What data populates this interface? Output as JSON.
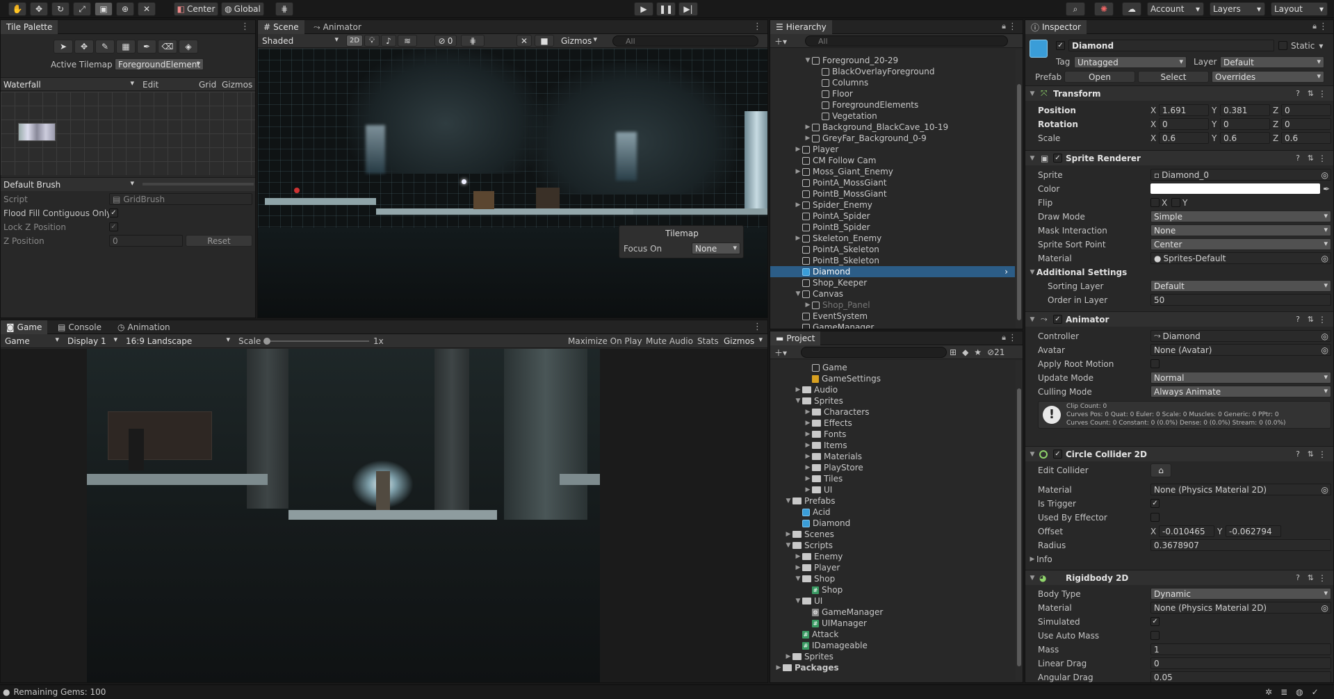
{
  "toolbar": {
    "center_label": "Center",
    "global_label": "Global",
    "account_label": "Account",
    "layers_label": "Layers",
    "layout_label": "Layout"
  },
  "tile_palette": {
    "tab_label": "Tile Palette",
    "active_tilemap_label": "Active Tilemap",
    "active_tilemap_value": "ForegroundElement",
    "palette_value": "Waterfall",
    "edit_label": "Edit",
    "grid_label": "Grid",
    "gizmos_label": "Gizmos",
    "brush_value": "Default Brush",
    "script_label": "Script",
    "script_value": "GridBrush",
    "flood_fill_label": "Flood Fill Contiguous Only",
    "lock_z_label": "Lock Z Position",
    "z_position_label": "Z Position",
    "z_position_value": "0",
    "reset_label": "Reset"
  },
  "scene": {
    "tab_scene": "Scene",
    "tab_animator": "Animator",
    "shading_value": "Shaded",
    "mode_2d": "2D",
    "hidden_count": "0",
    "gizmos_label": "Gizmos",
    "search_placeholder": "All",
    "overlay_title": "Tilemap",
    "focus_on_label": "Focus On",
    "focus_on_value": "None"
  },
  "game": {
    "tab_game": "Game",
    "tab_console": "Console",
    "tab_animation": "Animation",
    "game_dropdown": "Game",
    "display_value": "Display 1",
    "aspect_value": "16:9 Landscape",
    "scale_label": "Scale",
    "scale_value": "1x",
    "maximize_label": "Maximize On Play",
    "mute_label": "Mute Audio",
    "stats_label": "Stats",
    "gizmos_label": "Gizmos"
  },
  "hierarchy": {
    "tab_label": "Hierarchy",
    "search_placeholder": "All",
    "items": [
      {
        "label": "Foreground_20-29",
        "indent": 3,
        "arrow": "down",
        "icon": "cube"
      },
      {
        "label": "BlackOverlayForeground",
        "indent": 4,
        "arrow": "",
        "icon": "cube"
      },
      {
        "label": "Columns",
        "indent": 4,
        "arrow": "",
        "icon": "cube"
      },
      {
        "label": "Floor",
        "indent": 4,
        "arrow": "",
        "icon": "cube"
      },
      {
        "label": "ForegroundElements",
        "indent": 4,
        "arrow": "",
        "icon": "cube"
      },
      {
        "label": "Vegetation",
        "indent": 4,
        "arrow": "",
        "icon": "cube"
      },
      {
        "label": "Background_BlackCave_10-19",
        "indent": 3,
        "arrow": "right",
        "icon": "cube"
      },
      {
        "label": "GreyFar_Background_0-9",
        "indent": 3,
        "arrow": "right",
        "icon": "cube"
      },
      {
        "label": "Player",
        "indent": 2,
        "arrow": "right",
        "icon": "cube"
      },
      {
        "label": "CM Follow Cam",
        "indent": 2,
        "arrow": "",
        "icon": "cube"
      },
      {
        "label": "Moss_Giant_Enemy",
        "indent": 2,
        "arrow": "right",
        "icon": "cube"
      },
      {
        "label": "PointA_MossGiant",
        "indent": 2,
        "arrow": "",
        "icon": "cube"
      },
      {
        "label": "PointB_MossGiant",
        "indent": 2,
        "arrow": "",
        "icon": "cube"
      },
      {
        "label": "Spider_Enemy",
        "indent": 2,
        "arrow": "right",
        "icon": "cube"
      },
      {
        "label": "PointA_Spider",
        "indent": 2,
        "arrow": "",
        "icon": "cube"
      },
      {
        "label": "PointB_Spider",
        "indent": 2,
        "arrow": "",
        "icon": "cube"
      },
      {
        "label": "Skeleton_Enemy",
        "indent": 2,
        "arrow": "right",
        "icon": "cube"
      },
      {
        "label": "PointA_Skeleton",
        "indent": 2,
        "arrow": "",
        "icon": "cube"
      },
      {
        "label": "PointB_Skeleton",
        "indent": 2,
        "arrow": "",
        "icon": "cube"
      },
      {
        "label": "Diamond",
        "indent": 2,
        "arrow": "",
        "icon": "cube-blue",
        "selected": true
      },
      {
        "label": "Shop_Keeper",
        "indent": 2,
        "arrow": "",
        "icon": "cube"
      },
      {
        "label": "Canvas",
        "indent": 2,
        "arrow": "down",
        "icon": "cube"
      },
      {
        "label": "Shop_Panel",
        "indent": 3,
        "arrow": "right",
        "icon": "cube",
        "dim": true
      },
      {
        "label": "EventSystem",
        "indent": 2,
        "arrow": "",
        "icon": "cube"
      },
      {
        "label": "GameManager",
        "indent": 2,
        "arrow": "",
        "icon": "cube"
      }
    ]
  },
  "project": {
    "tab_label": "Project",
    "hidden_count": "21",
    "items": [
      {
        "label": "Game",
        "indent": 3,
        "arrow": "",
        "icon": "unity"
      },
      {
        "label": "GameSettings",
        "indent": 3,
        "arrow": "",
        "icon": "settings"
      },
      {
        "label": "Audio",
        "indent": 2,
        "arrow": "right",
        "icon": "folder"
      },
      {
        "label": "Sprites",
        "indent": 2,
        "arrow": "down",
        "icon": "folder"
      },
      {
        "label": "Characters",
        "indent": 3,
        "arrow": "right",
        "icon": "folder"
      },
      {
        "label": "Effects",
        "indent": 3,
        "arrow": "right",
        "icon": "folder"
      },
      {
        "label": "Fonts",
        "indent": 3,
        "arrow": "right",
        "icon": "folder"
      },
      {
        "label": "Items",
        "indent": 3,
        "arrow": "right",
        "icon": "folder"
      },
      {
        "label": "Materials",
        "indent": 3,
        "arrow": "right",
        "icon": "folder"
      },
      {
        "label": "PlayStore",
        "indent": 3,
        "arrow": "right",
        "icon": "folder"
      },
      {
        "label": "Tiles",
        "indent": 3,
        "arrow": "right",
        "icon": "folder"
      },
      {
        "label": "UI",
        "indent": 3,
        "arrow": "right",
        "icon": "folder"
      },
      {
        "label": "Prefabs",
        "indent": 1,
        "arrow": "down",
        "icon": "folder"
      },
      {
        "label": "Acid",
        "indent": 2,
        "arrow": "",
        "icon": "cube-blue"
      },
      {
        "label": "Diamond",
        "indent": 2,
        "arrow": "",
        "icon": "cube-blue"
      },
      {
        "label": "Scenes",
        "indent": 1,
        "arrow": "right",
        "icon": "folder"
      },
      {
        "label": "Scripts",
        "indent": 1,
        "arrow": "down",
        "icon": "folder"
      },
      {
        "label": "Enemy",
        "indent": 2,
        "arrow": "right",
        "icon": "folder"
      },
      {
        "label": "Player",
        "indent": 2,
        "arrow": "right",
        "icon": "folder"
      },
      {
        "label": "Shop",
        "indent": 2,
        "arrow": "down",
        "icon": "folder"
      },
      {
        "label": "Shop",
        "indent": 3,
        "arrow": "",
        "icon": "script"
      },
      {
        "label": "UI",
        "indent": 2,
        "arrow": "down",
        "icon": "folder"
      },
      {
        "label": "GameManager",
        "indent": 3,
        "arrow": "",
        "icon": "gear"
      },
      {
        "label": "UIManager",
        "indent": 3,
        "arrow": "",
        "icon": "script"
      },
      {
        "label": "Attack",
        "indent": 2,
        "arrow": "",
        "icon": "script"
      },
      {
        "label": "IDamageable",
        "indent": 2,
        "arrow": "",
        "icon": "script"
      },
      {
        "label": "Sprites",
        "indent": 1,
        "arrow": "right",
        "icon": "folder"
      },
      {
        "label": "Packages",
        "indent": 0,
        "arrow": "right",
        "icon": "folder",
        "bold": true
      }
    ]
  },
  "inspector": {
    "tab_label": "Inspector",
    "object_name": "Diamond",
    "static_label": "Static",
    "tag_label": "Tag",
    "tag_value": "Untagged",
    "layer_label": "Layer",
    "layer_value": "Default",
    "prefab_label": "Prefab",
    "open_label": "Open",
    "select_label": "Select",
    "overrides_label": "Overrides",
    "transform": {
      "title": "Transform",
      "position_label": "Position",
      "pos_x": "1.691",
      "pos_y": "0.381",
      "pos_z": "0",
      "rotation_label": "Rotation",
      "rot_x": "0",
      "rot_y": "0",
      "rot_z": "0",
      "scale_label": "Scale",
      "scl_x": "0.6",
      "scl_y": "0.6",
      "scl_z": "0.6"
    },
    "sprite_renderer": {
      "title": "Sprite Renderer",
      "sprite_label": "Sprite",
      "sprite_value": "Diamond_0",
      "color_label": "Color",
      "flip_label": "Flip",
      "flip_x": "X",
      "flip_y": "Y",
      "draw_mode_label": "Draw Mode",
      "draw_mode_value": "Simple",
      "mask_label": "Mask Interaction",
      "mask_value": "None",
      "sort_point_label": "Sprite Sort Point",
      "sort_point_value": "Center",
      "material_label": "Material",
      "material_value": "Sprites-Default",
      "additional_label": "Additional Settings",
      "sorting_layer_label": "Sorting Layer",
      "sorting_layer_value": "Default",
      "order_label": "Order in Layer",
      "order_value": "50"
    },
    "animator": {
      "title": "Animator",
      "controller_label": "Controller",
      "controller_value": "Diamond",
      "avatar_label": "Avatar",
      "avatar_value": "None (Avatar)",
      "root_motion_label": "Apply Root Motion",
      "update_label": "Update Mode",
      "update_value": "Normal",
      "culling_label": "Culling Mode",
      "culling_value": "Always Animate",
      "info_line1": "Clip Count: 0",
      "info_line2": "Curves Pos: 0 Quat: 0 Euler: 0 Scale: 0 Muscles: 0 Generic: 0 PPtr: 0",
      "info_line3": "Curves Count: 0 Constant: 0 (0.0%) Dense: 0 (0.0%) Stream: 0 (0.0%)"
    },
    "circle_collider": {
      "title": "Circle Collider 2D",
      "edit_label": "Edit Collider",
      "material_label": "Material",
      "material_value": "None (Physics Material 2D)",
      "trigger_label": "Is Trigger",
      "effector_label": "Used By Effector",
      "offset_label": "Offset",
      "offset_x": "-0.010465",
      "offset_y": "-0.062794",
      "radius_label": "Radius",
      "radius_value": "0.3678907",
      "info_label": "Info"
    },
    "rigidbody": {
      "title": "Rigidbody 2D",
      "body_type_label": "Body Type",
      "body_type_value": "Dynamic",
      "material_label": "Material",
      "material_value": "None (Physics Material 2D)",
      "simulated_label": "Simulated",
      "auto_mass_label": "Use Auto Mass",
      "mass_label": "Mass",
      "mass_value": "1",
      "linear_drag_label": "Linear Drag",
      "linear_drag_value": "0",
      "angular_drag_label": "Angular Drag",
      "angular_drag_value": "0.05"
    }
  },
  "status_bar": {
    "message": "Remaining Gems: 100"
  }
}
